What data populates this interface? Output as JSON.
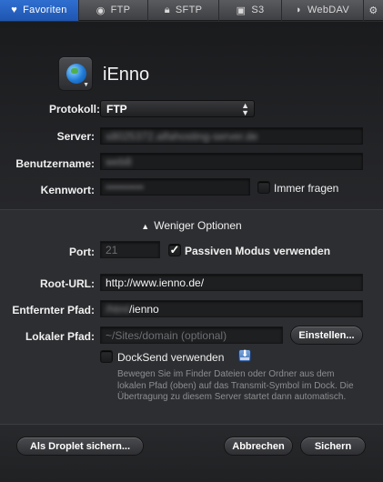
{
  "tabs": [
    {
      "label": "Favoriten",
      "icon": "heart-icon"
    },
    {
      "label": "FTP",
      "icon": "globe-icon"
    },
    {
      "label": "SFTP",
      "icon": "lock-icon"
    },
    {
      "label": "S3",
      "icon": "amazon-icon"
    },
    {
      "label": "WebDAV",
      "icon": "webdav-icon"
    }
  ],
  "settings_icon": "gear-icon",
  "server": {
    "name": "iEnno",
    "icon": "globe-server-icon"
  },
  "form": {
    "protocol_label": "Protokoll:",
    "protocol_value": "FTP",
    "server_label": "Server:",
    "server_value": "s8025372.alfahosting-server.de",
    "user_label": "Benutzername:",
    "user_value": "web8",
    "password_label": "Kennwort:",
    "password_value": "••••••••••",
    "always_ask_label": "Immer fragen",
    "always_ask_checked": false
  },
  "options": {
    "toggle_label": "Weniger Optionen",
    "port_label": "Port:",
    "port_placeholder": "21",
    "passive_label": "Passiven Modus verwenden",
    "passive_checked": true,
    "root_url_label": "Root-URL:",
    "root_url_value": "http://www.ienno.de/",
    "remote_path_label": "Entfernter Pfad:",
    "remote_path_hidden": "/html",
    "remote_path_value": "/ienno",
    "local_path_label": "Lokaler Pfad:",
    "local_path_placeholder": "~/Sites/domain (optional)",
    "set_button": "Einstellen...",
    "docksend_label": "DockSend verwenden",
    "docksend_checked": false,
    "help_text": "Bewegen Sie im Finder Dateien oder Ordner aus dem lokalen Pfad (oben) auf das Transmit-Symbol im Dock. Die Übertragung zu diesem Server startet dann automatisch."
  },
  "footer": {
    "droplet_button": "Als Droplet sichern...",
    "cancel_button": "Abbrechen",
    "save_button": "Sichern"
  },
  "colors": {
    "accent": "#2a66c8",
    "background": "#2b2c2f"
  }
}
